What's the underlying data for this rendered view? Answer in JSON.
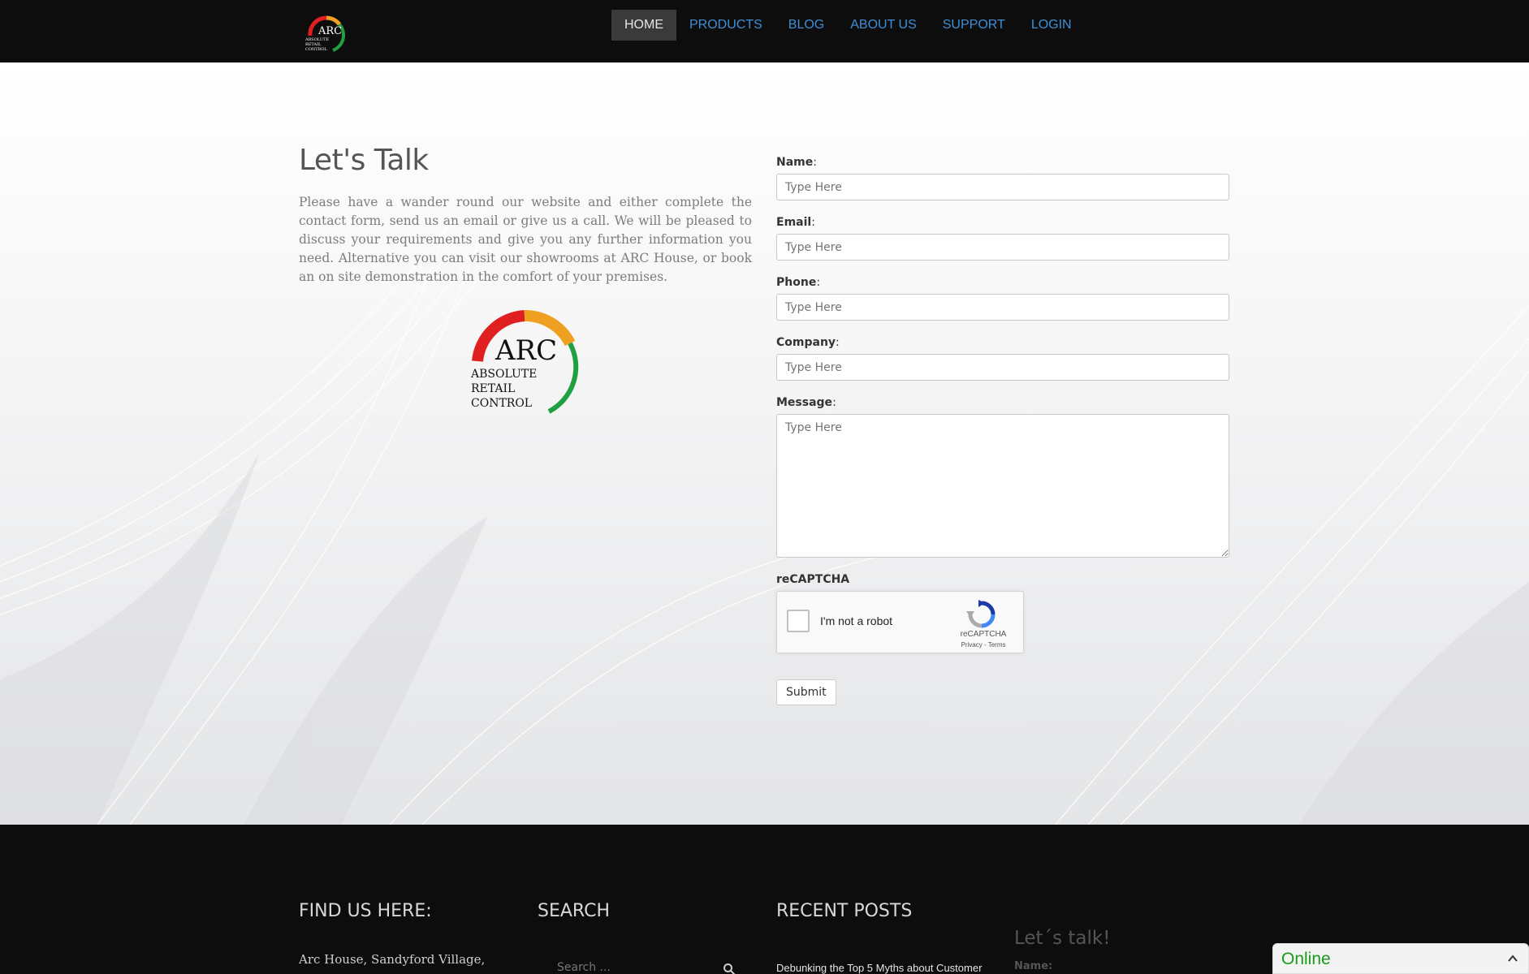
{
  "header": {
    "logo": {
      "icon": "arc-logo-icon",
      "text": "ARC",
      "lines": [
        "ABSOLUTE",
        "RETAIL",
        "CONTROL"
      ]
    },
    "nav": [
      {
        "label": "HOME",
        "active": true
      },
      {
        "label": "PRODUCTS",
        "active": false
      },
      {
        "label": "BLOG",
        "active": false
      },
      {
        "label": "ABOUT US",
        "active": false
      },
      {
        "label": "SUPPORT",
        "active": false
      },
      {
        "label": "LOGIN",
        "active": false
      }
    ]
  },
  "intro": {
    "title": "Let's Talk",
    "body": "Please have a wander round our website and either complete the contact form, send us an email or give us a call. We will be pleased to discuss your requirements and give you any further information you need. Alternative you can visit our showrooms at ARC House, or book an on site demonstration in the comfort of your premises.",
    "logo": {
      "text": "ARC",
      "line1": "ABSOLUTE",
      "line2": "RETAIL",
      "line3": "CONTROL"
    }
  },
  "form": {
    "name_label": "Name",
    "email_label": "Email",
    "phone_label": "Phone",
    "company_label": "Company",
    "message_label": "Message",
    "colon": ":",
    "placeholder": "Type Here",
    "recaptcha_label": "reCAPTCHA",
    "recaptcha_text": "I'm not a robot",
    "recaptcha_brand": "reCAPTCHA",
    "recaptcha_links": "Privacy - Terms",
    "submit_label": "Submit"
  },
  "footer": {
    "find_title": "FIND US HERE:",
    "address": "Arc House, Sandyford Village,",
    "search_title": "SEARCH",
    "search_placeholder": "Search ...",
    "posts_title": "RECENT POSTS",
    "post_1": "Debunking the Top 5 Myths about Customer",
    "lets_talk": "Let´s talk!",
    "name_label": "Name:"
  },
  "chat": {
    "status": "Online"
  },
  "colors": {
    "accent_link": "#3f8fd8",
    "nav_active_bg": "#3a3a3a",
    "logo_red": "#e02020",
    "logo_orange": "#f0a020",
    "logo_green": "#20a040",
    "chat_online": "#1a9a1a"
  }
}
